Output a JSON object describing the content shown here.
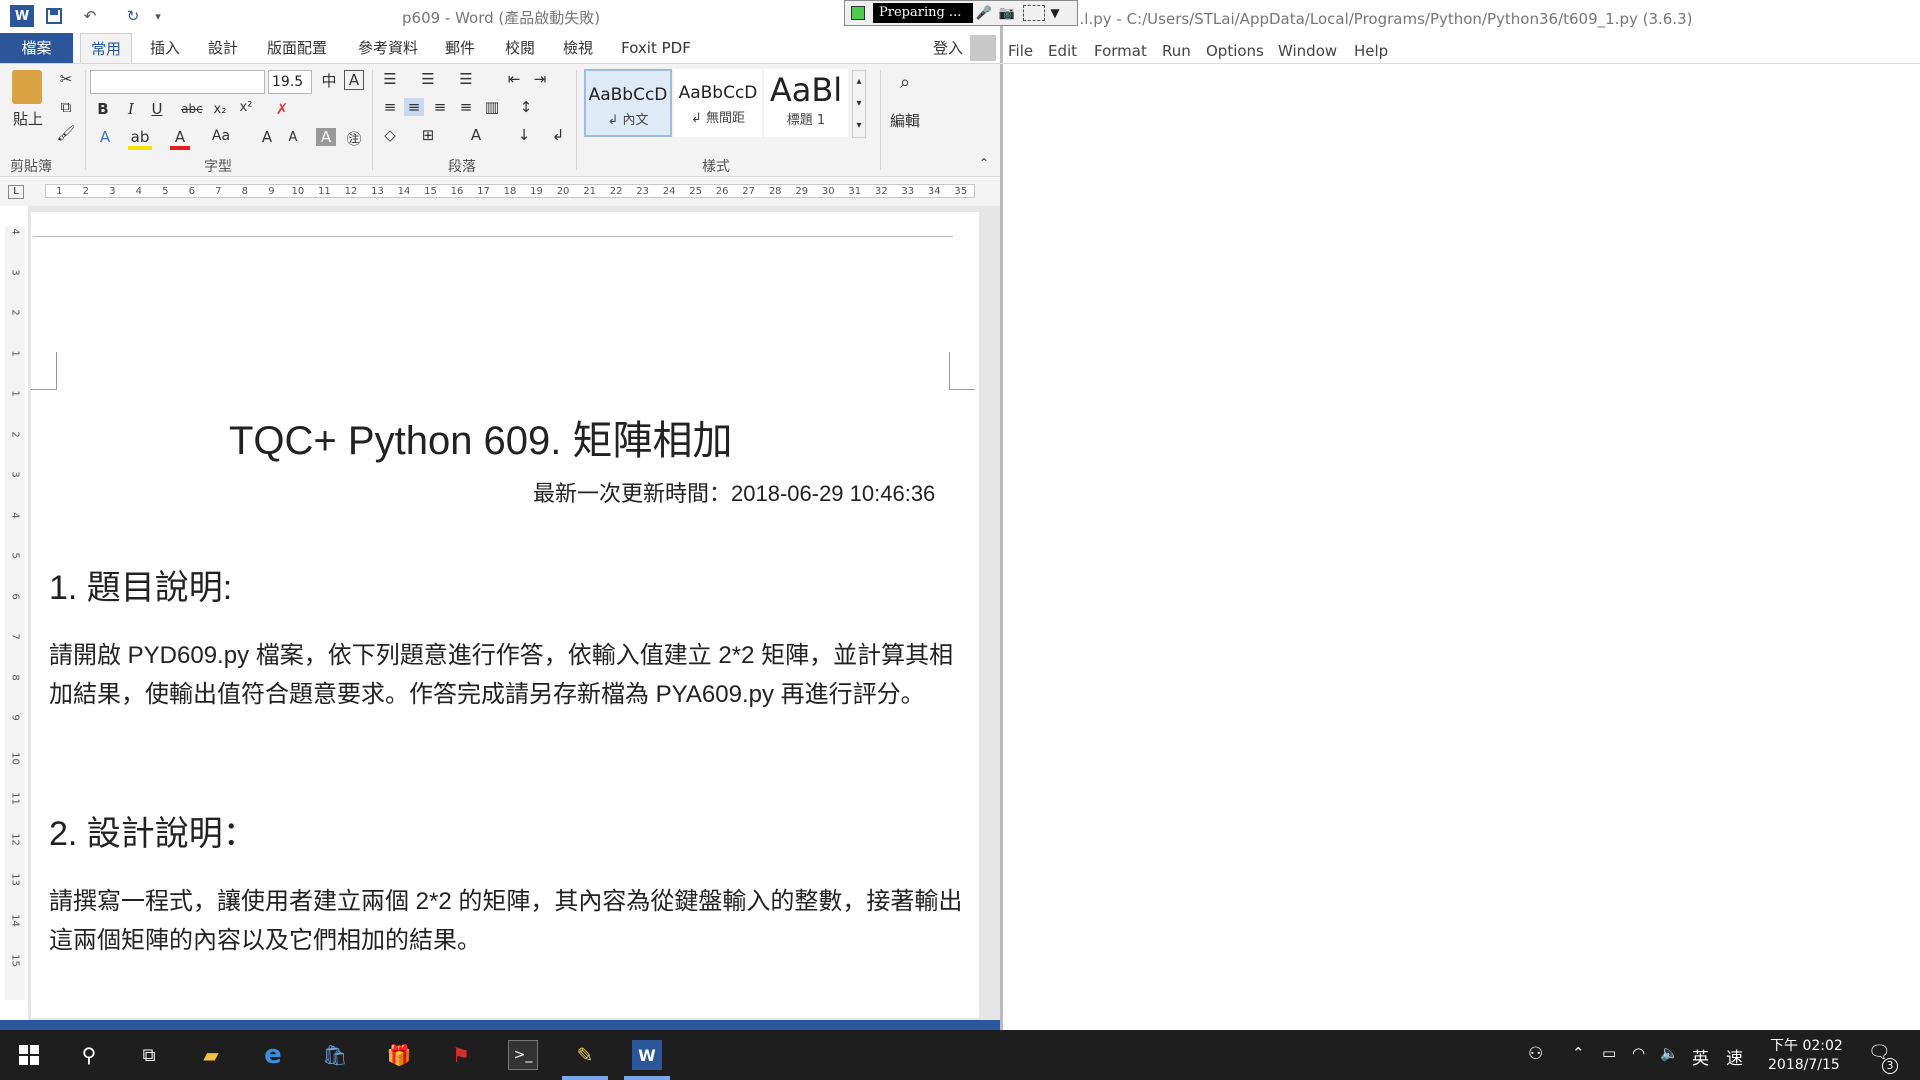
{
  "word": {
    "title": "p609 - Word (產品啟動失敗)",
    "tabs": [
      "檔案",
      "常用",
      "插入",
      "設計",
      "版面配置",
      "參考資料",
      "郵件",
      "校閱",
      "檢視",
      "Foxit PDF"
    ],
    "sign_in": "登入",
    "ribbon": {
      "paste": "貼上",
      "font_name": "",
      "font_size": "19.5",
      "groups": [
        "剪貼簿",
        "字型",
        "段落",
        "樣式",
        "編輯"
      ],
      "styles": [
        {
          "sample": "AaBbCcD",
          "name": "↲ 內文"
        },
        {
          "sample": "AaBbCcD",
          "name": "↲ 無間距"
        },
        {
          "sample": "AaBl",
          "name": "標題 1"
        }
      ],
      "edit": "編輯"
    },
    "ruler_ticks": [
      "1",
      "2",
      "3",
      "4",
      "5",
      "6",
      "7",
      "8",
      "9",
      "10",
      "11",
      "12",
      "13",
      "14",
      "15",
      "16",
      "17",
      "18",
      "19",
      "20",
      "21",
      "22",
      "23",
      "24",
      "25",
      "26",
      "27",
      "28",
      "29",
      "30",
      "31",
      "32",
      "33",
      "34",
      "35"
    ],
    "vruler_ticks": [
      "4",
      "3",
      "2",
      "1",
      "1",
      "2",
      "3",
      "4",
      "5",
      "6",
      "7",
      "8",
      "9",
      "10",
      "11",
      "12",
      "13",
      "14",
      "15"
    ],
    "doc": {
      "title": "TQC+ Python 609.  矩陣相加",
      "updated": "最新一次更新時間：2018-06-29 10:46:36",
      "h1": "1.  題目說明:",
      "p1": "請開啟 PYD609.py 檔案，依下列題意進行作答，依輸入值建立 2*2 矩陣，並計算其相加結果，使輸出值符合題意要求。作答完成請另存新檔為 PYA609.py 再進行評分。",
      "h2": "2.  設計說明：",
      "p2": "請撰寫一程式，讓使用者建立兩個 2*2 的矩陣，其內容為從鍵盤輸入的整數，接著輸出這兩個矩陣的內容以及它們相加的結果。"
    }
  },
  "recorder": {
    "status": "Preparing ..."
  },
  "idle": {
    "title": "...l.py - C:/Users/STLai/AppData/Local/Programs/Python/Python36/t609_1.py (3.6.3)",
    "menu": [
      "File",
      "Edit",
      "Format",
      "Run",
      "Options",
      "Window",
      "Help"
    ]
  },
  "taskbar": {
    "ime_lang": "英",
    "ime_mode": "速",
    "time": "下午 02:02",
    "date": "2018/7/15",
    "notifications": "3"
  }
}
